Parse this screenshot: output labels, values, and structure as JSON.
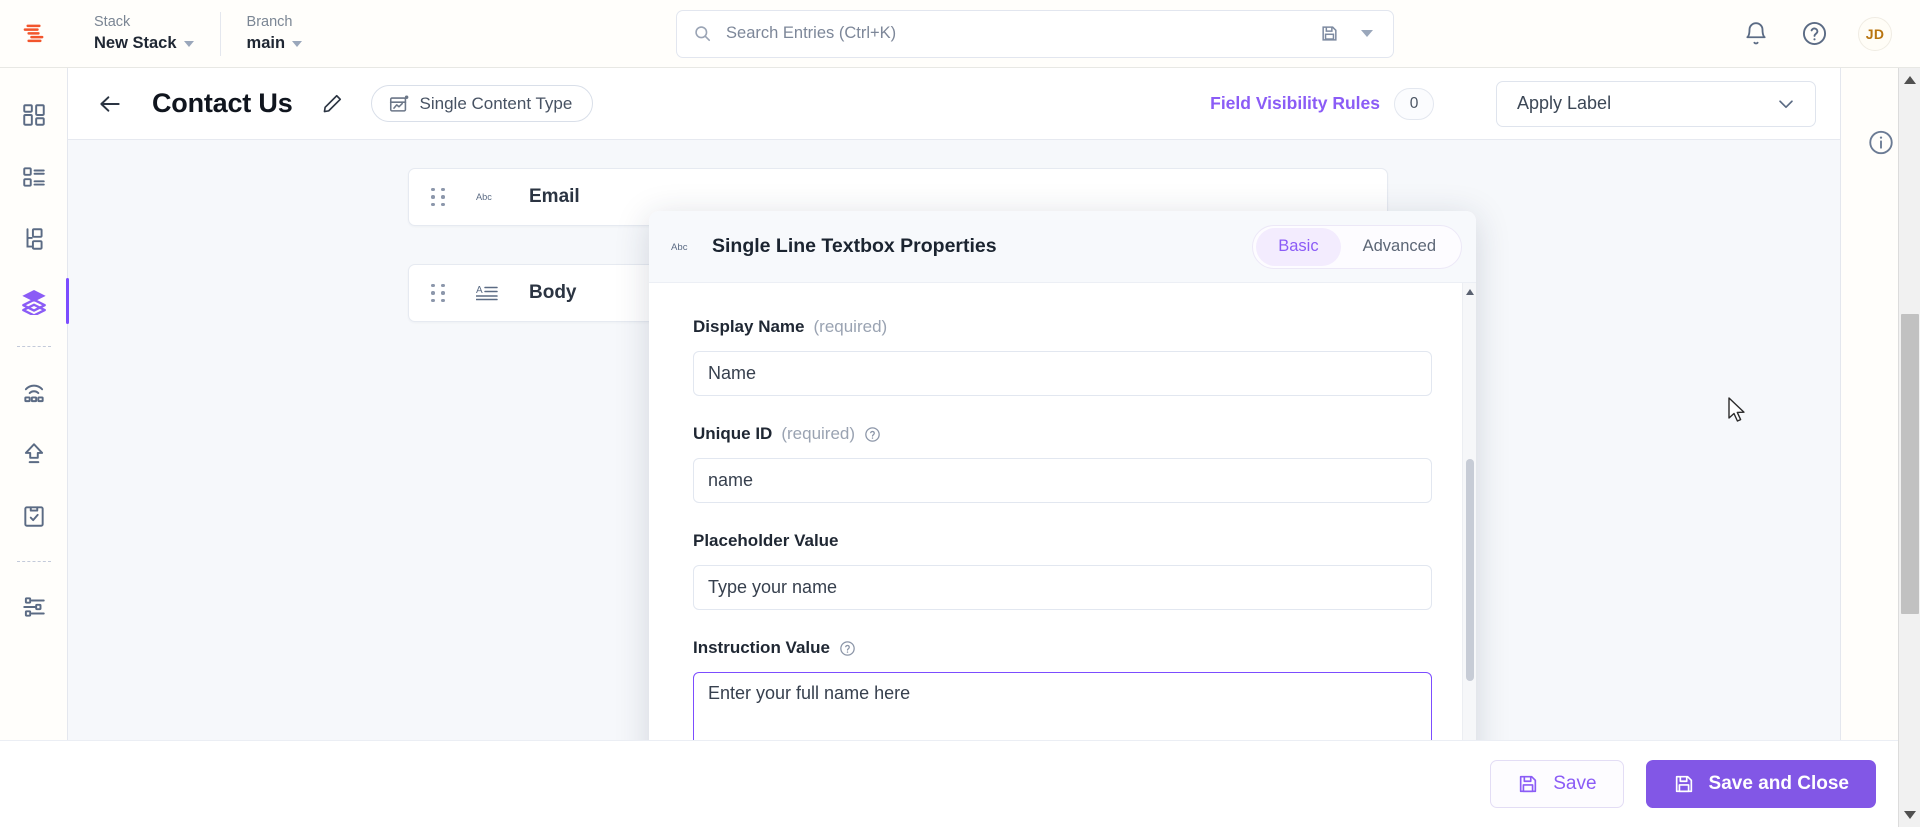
{
  "topbar": {
    "logo_icon": "contentstack-logo-icon",
    "stack": {
      "label": "Stack",
      "value": "New Stack"
    },
    "branch": {
      "label": "Branch",
      "value": "main"
    },
    "search": {
      "icon": "search-icon",
      "placeholder": "Search Entries (Ctrl+K)",
      "value": ""
    },
    "search_save_icon": "save-disk-icon",
    "search_caret_icon": "chevron-down-icon",
    "notifications_icon": "bell-icon",
    "help_icon": "question-circle-icon",
    "avatar_initials": "JD"
  },
  "sidebar": {
    "items": [
      {
        "icon": "dashboard-grid-icon",
        "name": "dashboard",
        "active": false
      },
      {
        "icon": "content-types-list-icon",
        "name": "content-types",
        "active": false
      },
      {
        "icon": "hierarchy-tree-icon",
        "name": "taxonomy",
        "active": false
      },
      {
        "icon": "layers-stack-icon",
        "name": "content-models",
        "active": true
      },
      {
        "icon": "broadcast-live-preview-icon",
        "name": "live-preview",
        "active": false
      },
      {
        "icon": "publish-upload-icon",
        "name": "publish-queue",
        "active": false
      },
      {
        "icon": "clipboard-check-icon",
        "name": "audit-log",
        "active": false
      },
      {
        "icon": "sliders-settings-icon",
        "name": "settings",
        "active": false
      }
    ]
  },
  "subheader": {
    "back_icon": "arrow-left-icon",
    "title": "Contact Us",
    "edit_icon": "pencil-icon",
    "type_pill": {
      "icon": "single-content-type-icon",
      "label": "Single Content Type"
    },
    "field_visibility": {
      "label": "Field Visibility Rules",
      "count": "0"
    },
    "apply_label": {
      "value": "Apply Label",
      "icon": "chevron-down-icon"
    }
  },
  "content": {
    "fields": [
      {
        "type_icon": "abc-single-line-icon",
        "name": "Email",
        "grip_icon": "drag-handle-icon"
      },
      {
        "type_icon": "multi-line-text-icon",
        "name": "Body",
        "grip_icon": "drag-handle-icon"
      }
    ]
  },
  "right_rail": {
    "info_icon": "info-circle-icon"
  },
  "modal": {
    "type_icon": "abc-single-line-icon",
    "title": "Single Line Textbox Properties",
    "tabs": [
      {
        "label": "Basic",
        "active": true
      },
      {
        "label": "Advanced",
        "active": false
      }
    ],
    "fields": [
      {
        "label": "Display Name",
        "required_text": "(required)",
        "has_help": false,
        "value": "Name",
        "placeholder": "",
        "kind": "input",
        "name": "display-name-field"
      },
      {
        "label": "Unique ID",
        "required_text": "(required)",
        "has_help": true,
        "value": "name",
        "placeholder": "",
        "kind": "input",
        "name": "unique-id-field"
      },
      {
        "label": "Placeholder Value",
        "required_text": "",
        "has_help": false,
        "value": "Type your name",
        "placeholder": "",
        "kind": "input",
        "name": "placeholder-value-field"
      },
      {
        "label": "Instruction Value",
        "required_text": "",
        "has_help": true,
        "value": "Enter your full name here",
        "placeholder": "",
        "kind": "textarea",
        "name": "instruction-value-field"
      }
    ]
  },
  "footer": {
    "save": {
      "label": "Save",
      "icon": "save-disk-icon"
    },
    "save_and_close": {
      "label": "Save and Close",
      "icon": "save-disk-icon"
    }
  },
  "colors": {
    "accent_purple": "#8b5cf6",
    "primary_button": "#8257e6",
    "focus_border": "#7c4dff",
    "logo_orange": "#f2552c",
    "content_bg": "#f6f8fb",
    "text_dark": "#1f2733",
    "text_muted": "#7b8694"
  }
}
